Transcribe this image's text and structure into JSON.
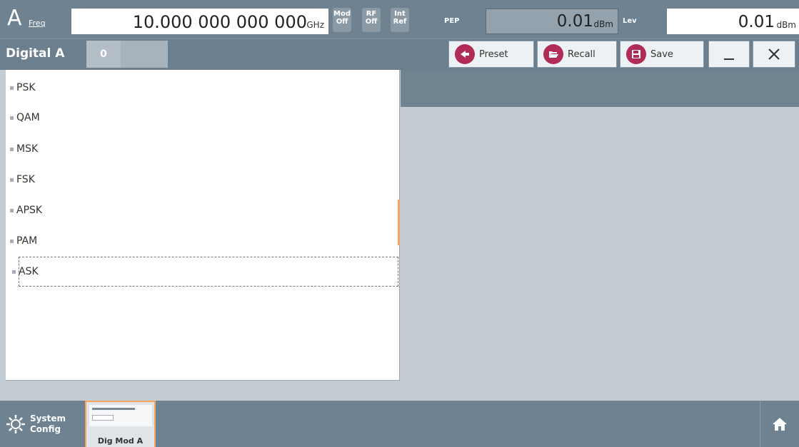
{
  "status_bar": {
    "channel": "A",
    "freq_label": "Freq",
    "freq_value": "10.000 000 000 000",
    "freq_unit": "GHz",
    "indicators": [
      {
        "line1": "Mod",
        "line2": "Off"
      },
      {
        "line1": "RF",
        "line2": "Off"
      },
      {
        "line1": "Int",
        "line2": "Ref"
      }
    ],
    "pep_label": "PEP",
    "pep_value": "0.01",
    "pep_unit": "dBm",
    "level_label": "Lev",
    "level_value": "0.01",
    "level_unit": "dBm"
  },
  "dialog": {
    "title": "Digital A",
    "tab_value": "0",
    "preset_label": "Preset",
    "recall_label": "Recall",
    "save_label": "Save"
  },
  "tree": {
    "items": [
      "PSK",
      "QAM",
      "MSK",
      "FSK",
      "APSK",
      "PAM",
      "ASK"
    ],
    "selected": "ASK"
  },
  "taskbar": {
    "system_line1": "System",
    "system_line2": "Config",
    "thumbnail_label": "Dig Mod A"
  },
  "colors": {
    "bar": "#6e8291",
    "accent": "#b02b55",
    "highlight": "#f2a65a"
  }
}
